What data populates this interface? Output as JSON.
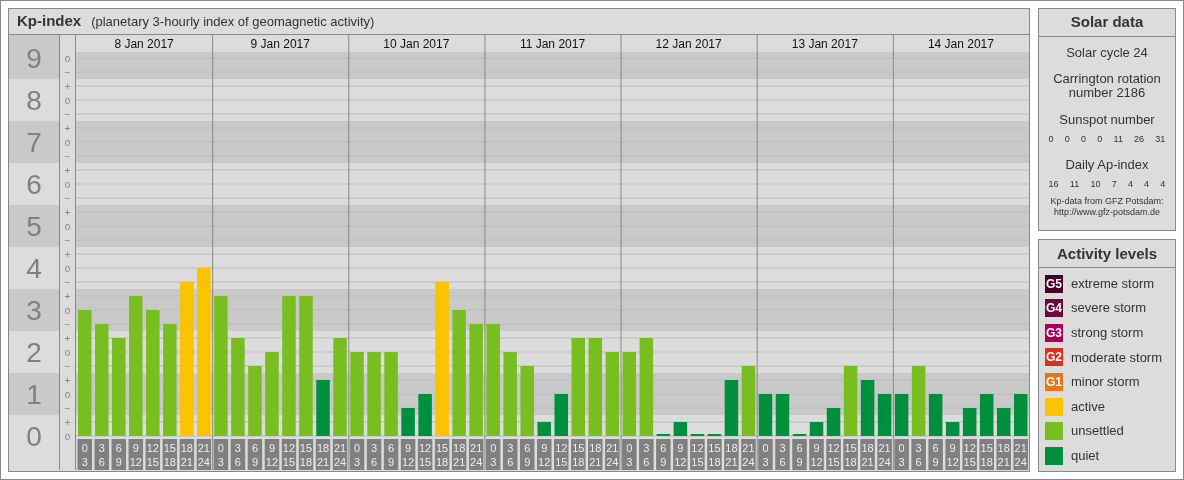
{
  "header": {
    "title": "Kp-index",
    "subtitle": "(planetary 3-hourly index of geomagnetic activity)"
  },
  "scale_marks": [
    "o",
    "−",
    "+",
    "o",
    "−",
    "+",
    "o",
    "−",
    "+",
    "o",
    "−",
    "+",
    "o",
    "−",
    "+",
    "o",
    "−",
    "+",
    "o",
    "−",
    "+",
    "o",
    "−",
    "+",
    "o",
    "−",
    "+",
    "o"
  ],
  "days": [
    {
      "date": "8 Jan 2017",
      "intervals": [
        [
          "0",
          "3"
        ],
        [
          "3",
          "6"
        ],
        [
          "6",
          "9"
        ],
        [
          "9",
          "12"
        ],
        [
          "12",
          "15"
        ],
        [
          "15",
          "18"
        ],
        [
          "18",
          "21"
        ],
        [
          "21",
          "24"
        ]
      ]
    },
    {
      "date": "9 Jan 2017",
      "intervals": [
        [
          "0",
          "3"
        ],
        [
          "3",
          "6"
        ],
        [
          "6",
          "9"
        ],
        [
          "9",
          "12"
        ],
        [
          "12",
          "15"
        ],
        [
          "15",
          "18"
        ],
        [
          "18",
          "21"
        ],
        [
          "21",
          "24"
        ]
      ]
    },
    {
      "date": "10 Jan 2017",
      "intervals": [
        [
          "0",
          "3"
        ],
        [
          "3",
          "6"
        ],
        [
          "6",
          "9"
        ],
        [
          "9",
          "12"
        ],
        [
          "12",
          "15"
        ],
        [
          "15",
          "18"
        ],
        [
          "18",
          "21"
        ],
        [
          "21",
          "24"
        ]
      ]
    },
    {
      "date": "11 Jan 2017",
      "intervals": [
        [
          "0",
          "3"
        ],
        [
          "3",
          "6"
        ],
        [
          "6",
          "9"
        ],
        [
          "9",
          "12"
        ],
        [
          "12",
          "15"
        ],
        [
          "15",
          "18"
        ],
        [
          "18",
          "21"
        ],
        [
          "21",
          "24"
        ]
      ]
    },
    {
      "date": "12 Jan 2017",
      "intervals": [
        [
          "0",
          "3"
        ],
        [
          "3",
          "6"
        ],
        [
          "6",
          "9"
        ],
        [
          "9",
          "12"
        ],
        [
          "12",
          "15"
        ],
        [
          "15",
          "18"
        ],
        [
          "18",
          "21"
        ],
        [
          "21",
          "24"
        ]
      ]
    },
    {
      "date": "13 Jan 2017",
      "intervals": [
        [
          "0",
          "3"
        ],
        [
          "3",
          "6"
        ],
        [
          "6",
          "9"
        ],
        [
          "9",
          "12"
        ],
        [
          "12",
          "15"
        ],
        [
          "15",
          "18"
        ],
        [
          "18",
          "21"
        ],
        [
          "21",
          "24"
        ]
      ]
    },
    {
      "date": "14 Jan 2017",
      "intervals": [
        [
          "0",
          "3"
        ],
        [
          "3",
          "6"
        ],
        [
          "6",
          "9"
        ],
        [
          "9",
          "12"
        ],
        [
          "12",
          "15"
        ],
        [
          "15",
          "18"
        ],
        [
          "18",
          "21"
        ],
        [
          "21",
          "24"
        ]
      ]
    }
  ],
  "chart_data": {
    "type": "bar",
    "ylim": [
      0,
      9
    ],
    "yticks": [
      0,
      1,
      2,
      3,
      4,
      5,
      6,
      7,
      8,
      9
    ],
    "grid": true,
    "values": [
      3,
      2.67,
      2.33,
      3.33,
      3,
      2.67,
      3.67,
      4,
      3.33,
      2.33,
      1.67,
      2,
      3.33,
      3.33,
      1.33,
      2.33,
      2,
      2,
      2,
      0.67,
      1,
      3.67,
      3,
      2.67,
      2.67,
      2,
      1.67,
      0.33,
      1,
      2.33,
      2.33,
      2,
      2,
      2.33,
      0,
      0.33,
      0,
      0,
      1.33,
      1.67,
      1,
      1,
      0,
      0.33,
      0.67,
      1.67,
      1.33,
      1,
      1,
      1.67,
      1,
      0.33,
      0.67,
      1,
      0.67,
      1
    ]
  },
  "solar_data": {
    "title": "Solar data",
    "cycle": "Solar cycle 24",
    "carrington": "Carrington rotation number 2186",
    "sunspot_label": "Sunspot number",
    "sunspot_values": [
      "0",
      "0",
      "0",
      "0",
      "11",
      "26",
      "31"
    ],
    "ap_label": "Daily Ap-index",
    "ap_values": [
      "16",
      "11",
      "10",
      "7",
      "4",
      "4",
      "4"
    ],
    "source": "Kp-data from GFZ Potsdam:",
    "source_url": "http://www.gfz-potsdam.de"
  },
  "activity_levels": {
    "title": "Activity levels",
    "items": [
      {
        "badge": "G5",
        "label": "extreme storm",
        "color": "#4a0026"
      },
      {
        "badge": "G4",
        "label": "severe storm",
        "color": "#6c0a3c"
      },
      {
        "badge": "G3",
        "label": "strong storm",
        "color": "#a8005c"
      },
      {
        "badge": "G2",
        "label": "moderate storm",
        "color": "#d8321e"
      },
      {
        "badge": "G1",
        "label": "minor storm",
        "color": "#e3771a"
      },
      {
        "label": "active",
        "color": "#f9c300"
      },
      {
        "label": "unsettled",
        "color": "#79be21"
      },
      {
        "label": "quiet",
        "color": "#00903d"
      }
    ]
  }
}
